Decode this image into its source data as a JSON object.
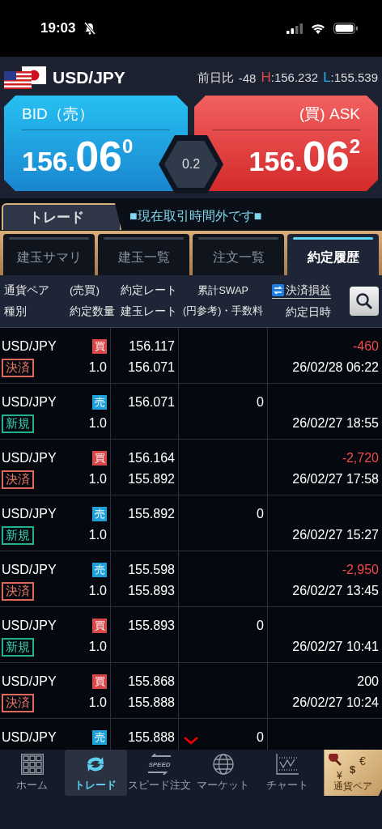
{
  "status_bar": {
    "time": "19:03"
  },
  "quote": {
    "pair": "USD/JPY",
    "change_label": "前日比",
    "change": "-48",
    "high_label": "H",
    "high": ":156.232",
    "low_label": "L",
    "low": ":155.539",
    "bid": {
      "label": "BID（売）",
      "price_main": "156.",
      "price_pips": "06",
      "price_fraction": "0"
    },
    "ask": {
      "label": "(買) ASK",
      "price_main": "156.",
      "price_pips": "06",
      "price_fraction": "2"
    },
    "spread": "0.2"
  },
  "main_tab": {
    "label": "トレード",
    "selected": true
  },
  "notice": "■現在取引時間外です■",
  "tabs": [
    {
      "label": "建玉サマリ",
      "selected": false
    },
    {
      "label": "建玉一覧",
      "selected": false
    },
    {
      "label": "注文一覧",
      "selected": false
    },
    {
      "label": "約定履歴",
      "selected": true
    }
  ],
  "table": {
    "columns": [
      [
        "通貨ペア",
        "(売買)",
        "種別",
        "約定数量"
      ],
      [
        "約定レート",
        "建玉レート"
      ],
      [
        "累計SWAP",
        "(円参考)・手数料"
      ],
      [
        "決済損益",
        "約定日時"
      ]
    ],
    "rows": [
      {
        "pair": "USD/JPY",
        "buy": true,
        "side_label": "買",
        "closing": true,
        "type_label": "決済",
        "quantity": "1.0",
        "rate": "156.117",
        "position_rate": "156.071",
        "pl": "-460",
        "loss": true,
        "datetime": "26/02/28 06:22"
      },
      {
        "pair": "USD/JPY",
        "buy": false,
        "side_label": "売",
        "closing": false,
        "type_label": "新規",
        "quantity": "1.0",
        "rate": "156.071",
        "swap": "0",
        "datetime": "26/02/27 18:55"
      },
      {
        "pair": "USD/JPY",
        "buy": true,
        "side_label": "買",
        "closing": true,
        "type_label": "決済",
        "quantity": "1.0",
        "rate": "156.164",
        "position_rate": "155.892",
        "pl": "-2,720",
        "loss": true,
        "datetime": "26/02/27 17:58"
      },
      {
        "pair": "USD/JPY",
        "buy": false,
        "side_label": "売",
        "closing": false,
        "type_label": "新規",
        "quantity": "1.0",
        "rate": "155.892",
        "swap": "0",
        "datetime": "26/02/27 15:27"
      },
      {
        "pair": "USD/JPY",
        "buy": false,
        "side_label": "売",
        "closing": true,
        "type_label": "決済",
        "quantity": "1.0",
        "rate": "155.598",
        "position_rate": "155.893",
        "pl": "-2,950",
        "loss": true,
        "datetime": "26/02/27 13:45"
      },
      {
        "pair": "USD/JPY",
        "buy": true,
        "side_label": "買",
        "closing": false,
        "type_label": "新規",
        "quantity": "1.0",
        "rate": "155.893",
        "swap": "0",
        "datetime": "26/02/27 10:41"
      },
      {
        "pair": "USD/JPY",
        "buy": true,
        "side_label": "買",
        "closing": true,
        "type_label": "決済",
        "quantity": "1.0",
        "rate": "155.868",
        "position_rate": "155.888",
        "pl": "200",
        "loss": false,
        "datetime": "26/02/27 10:24"
      },
      {
        "pair": "USD/JPY",
        "buy": false,
        "side_label": "売",
        "rate": "155.888",
        "swap": "0"
      }
    ]
  },
  "nav": {
    "items": [
      {
        "kind": "home",
        "label": "ホーム",
        "selected": false
      },
      {
        "kind": "trade",
        "label": "トレード",
        "selected": true
      },
      {
        "kind": "speed",
        "label": "スピード注文",
        "icon_text": "SPEED",
        "selected": false
      },
      {
        "kind": "market",
        "label": "マーケット",
        "selected": false
      },
      {
        "kind": "chart",
        "label": "チャート",
        "selected": false
      }
    ],
    "pair_button": {
      "label": "通貨ペア",
      "symbols": [
        "€",
        "$",
        "¥"
      ]
    }
  }
}
